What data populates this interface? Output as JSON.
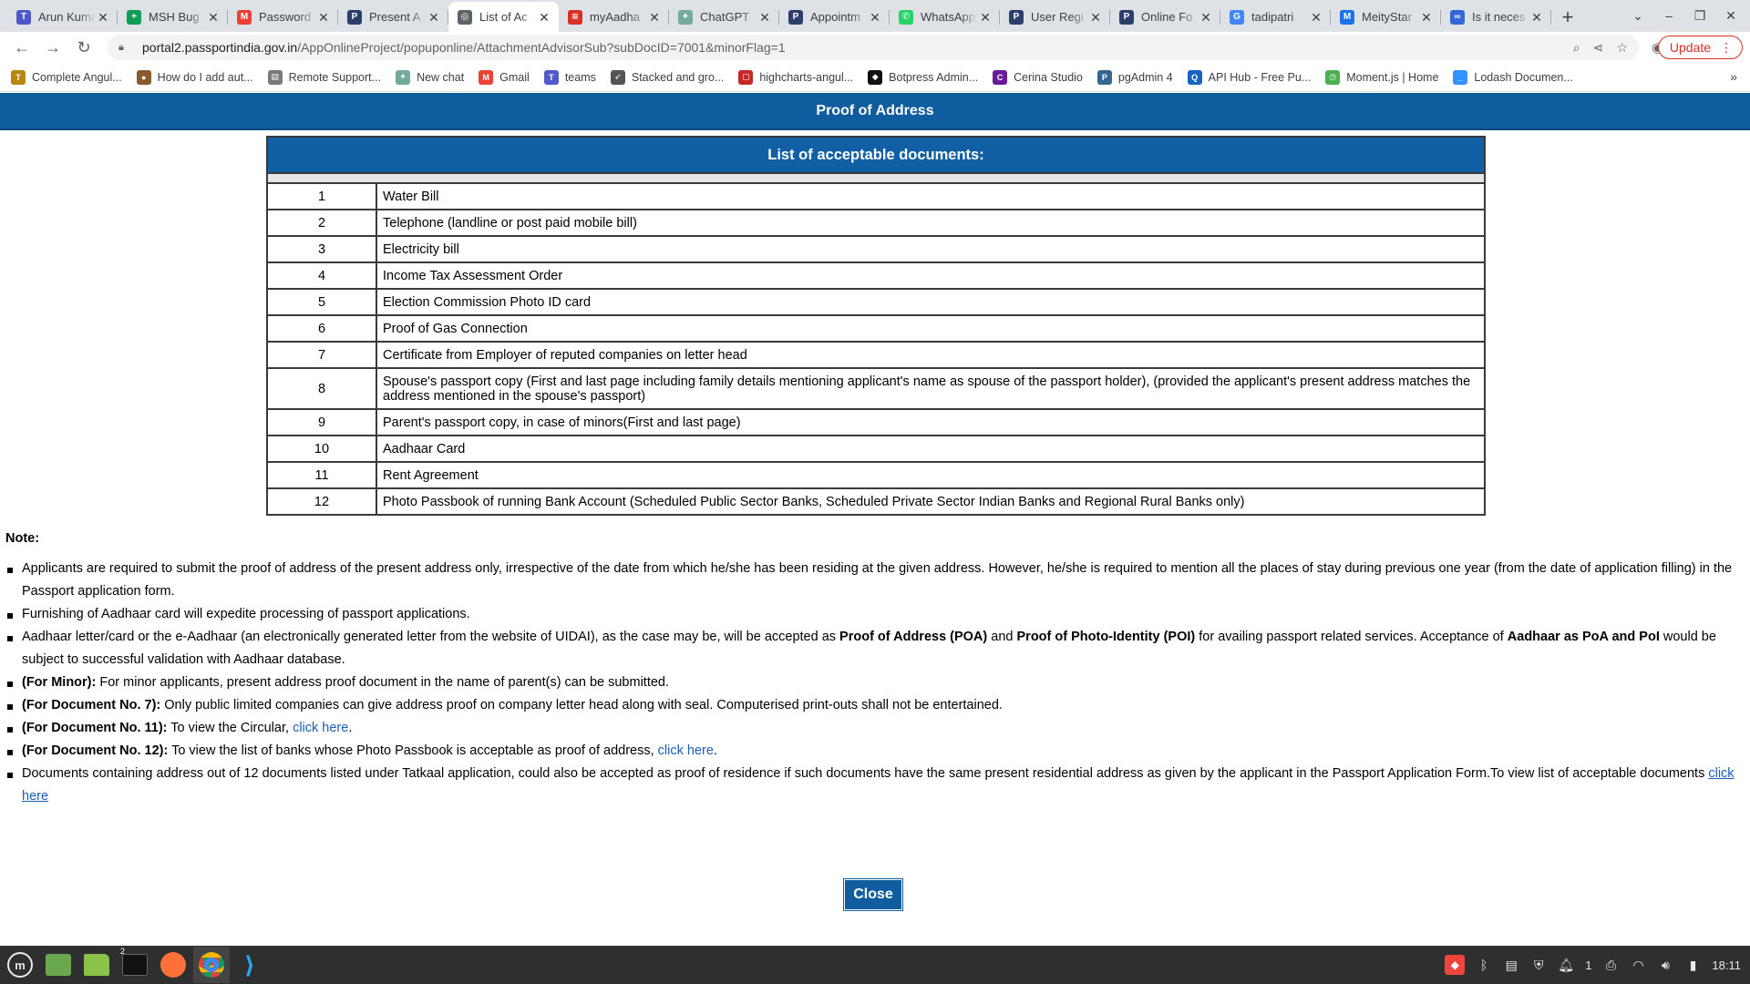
{
  "browser": {
    "tabs": [
      {
        "title": "Arun Kumar",
        "fav_color": "#5059c9",
        "fav_glyph": "T",
        "active": false
      },
      {
        "title": "MSH Bug",
        "fav_color": "#0f9d58",
        "fav_glyph": "+",
        "active": false
      },
      {
        "title": "Password",
        "fav_color": "#ea4335",
        "fav_glyph": "M",
        "active": false
      },
      {
        "title": "Present A",
        "fav_color": "#2c3e6b",
        "fav_glyph": "P",
        "active": false
      },
      {
        "title": "List of Ac",
        "fav_color": "#5f6368",
        "fav_glyph": "◎",
        "active": true
      },
      {
        "title": "myAadha",
        "fav_color": "#d93025",
        "fav_glyph": "≋",
        "active": false
      },
      {
        "title": "ChatGPT",
        "fav_color": "#74aa9c",
        "fav_glyph": "✦",
        "active": false
      },
      {
        "title": "Appointm",
        "fav_color": "#2c3e6b",
        "fav_glyph": "P",
        "active": false
      },
      {
        "title": "WhatsApp",
        "fav_color": "#25d366",
        "fav_glyph": "✆",
        "active": false
      },
      {
        "title": "User Regi",
        "fav_color": "#2c3e6b",
        "fav_glyph": "P",
        "active": false
      },
      {
        "title": "Online Fo",
        "fav_color": "#2c3e6b",
        "fav_glyph": "P",
        "active": false
      },
      {
        "title": "tadipatri",
        "fav_color": "#4285f4",
        "fav_glyph": "G",
        "active": false
      },
      {
        "title": "MeityStar",
        "fav_color": "#1a73e8",
        "fav_glyph": "M",
        "active": false
      },
      {
        "title": "Is it neces",
        "fav_color": "#3367d6",
        "fav_glyph": "∞",
        "active": false
      }
    ],
    "url_host": "portal2.passportindia.gov.in",
    "url_path": "/AppOnlineProject/popuponline/AttachmentAdvisorSub?subDocID=7001&minorFlag=1",
    "update_label": "Update",
    "bookmarks": [
      {
        "label": "Complete Angul...",
        "color": "#b8860b",
        "glyph": "T"
      },
      {
        "label": "How do I add aut...",
        "color": "#8b5a2b",
        "glyph": "●"
      },
      {
        "label": "Remote Support...",
        "color": "#7a7a7a",
        "glyph": "▤"
      },
      {
        "label": "New chat",
        "color": "#74aa9c",
        "glyph": "✦"
      },
      {
        "label": "Gmail",
        "color": "#ea4335",
        "glyph": "M"
      },
      {
        "label": "teams",
        "color": "#5059c9",
        "glyph": "T"
      },
      {
        "label": "Stacked and gro...",
        "color": "#555555",
        "glyph": "➶"
      },
      {
        "label": "highcharts-angul...",
        "color": "#c62828",
        "glyph": "▢"
      },
      {
        "label": "Botpress Admin...",
        "color": "#111111",
        "glyph": "◆"
      },
      {
        "label": "Cerina Studio",
        "color": "#6a1b9a",
        "glyph": "C"
      },
      {
        "label": "pgAdmin 4",
        "color": "#336791",
        "glyph": "P"
      },
      {
        "label": "API Hub - Free Pu...",
        "color": "#1565c0",
        "glyph": "Q"
      },
      {
        "label": "Moment.js | Home",
        "color": "#4caf50",
        "glyph": "◷"
      },
      {
        "label": "Lodash Documen...",
        "color": "#3492ff",
        "glyph": "_"
      }
    ]
  },
  "page": {
    "header_title": "Proof of Address",
    "table_title": "List of acceptable documents:",
    "documents": [
      {
        "no": "1",
        "name": "Water Bill"
      },
      {
        "no": "2",
        "name": "Telephone (landline or post paid mobile bill)"
      },
      {
        "no": "3",
        "name": "Electricity bill"
      },
      {
        "no": "4",
        "name": "Income Tax Assessment Order"
      },
      {
        "no": "5",
        "name": "Election Commission Photo ID card"
      },
      {
        "no": "6",
        "name": "Proof of Gas Connection"
      },
      {
        "no": "7",
        "name": "Certificate from Employer of reputed companies on letter head"
      },
      {
        "no": "8",
        "name": "Spouse's passport copy (First and last page including family details mentioning applicant's name as spouse of the passport holder), (provided the applicant's present address matches the address mentioned in the spouse's passport)"
      },
      {
        "no": "9",
        "name": "Parent's passport copy, in case of minors(First and last page)"
      },
      {
        "no": "10",
        "name": "Aadhaar Card"
      },
      {
        "no": "11",
        "name": "Rent Agreement"
      },
      {
        "no": "12",
        "name": "Photo Passbook of running Bank Account (Scheduled Public Sector Banks, Scheduled Private Sector Indian Banks and Regional Rural Banks only)"
      }
    ],
    "note_label": "Note:",
    "notes": {
      "n1": "Applicants are required to submit the proof of address of the present address only, irrespective of the date from which he/she has been residing at the given address. However, he/she is required to mention all the places of stay during previous one year (from the date of application filling) in the Passport application form.",
      "n2": "Furnishing of Aadhaar card will expedite processing of passport applications.",
      "n3_a": "Aadhaar letter/card or the e-Aadhaar (an electronically generated letter from the website of UIDAI), as the case may be, will be accepted as ",
      "n3_b": "Proof of Address (POA)",
      "n3_c": " and ",
      "n3_d": "Proof of Photo-Identity (POI)",
      "n3_e": " for availing passport related services. Acceptance of ",
      "n3_f": "Aadhaar as PoA and PoI",
      "n3_g": " would be subject to successful validation with Aadhaar database.",
      "n4_b": "(For Minor):",
      "n4_t": " For minor applicants, present address proof document in the name of parent(s) can be submitted.",
      "n5_b": "(For Document No. 7):",
      "n5_t": " Only public limited companies can give address proof on company letter head along with seal. Computerised print-outs shall not be entertained.",
      "n6_b": "(For Document No. 11):",
      "n6_t": " To view the Circular, ",
      "n6_link": "click here",
      "n6_end": ".",
      "n7_b": "(For Document No. 12):",
      "n7_t": " To view the list of banks whose Photo Passbook is acceptable as proof of address, ",
      "n7_link": "click here",
      "n7_end": ".",
      "n8_t": "Documents containing address out of 12 documents listed under Tatkaal application, could also be accepted as proof of residence if such documents have the same present residential address as given by the applicant in the Passport Application Form.To view list of acceptable documents ",
      "n8_link": "click here"
    },
    "close_label": "Close"
  },
  "taskbar": {
    "workspace_badge": "2",
    "tray_count": "1",
    "clock": "18:11"
  }
}
